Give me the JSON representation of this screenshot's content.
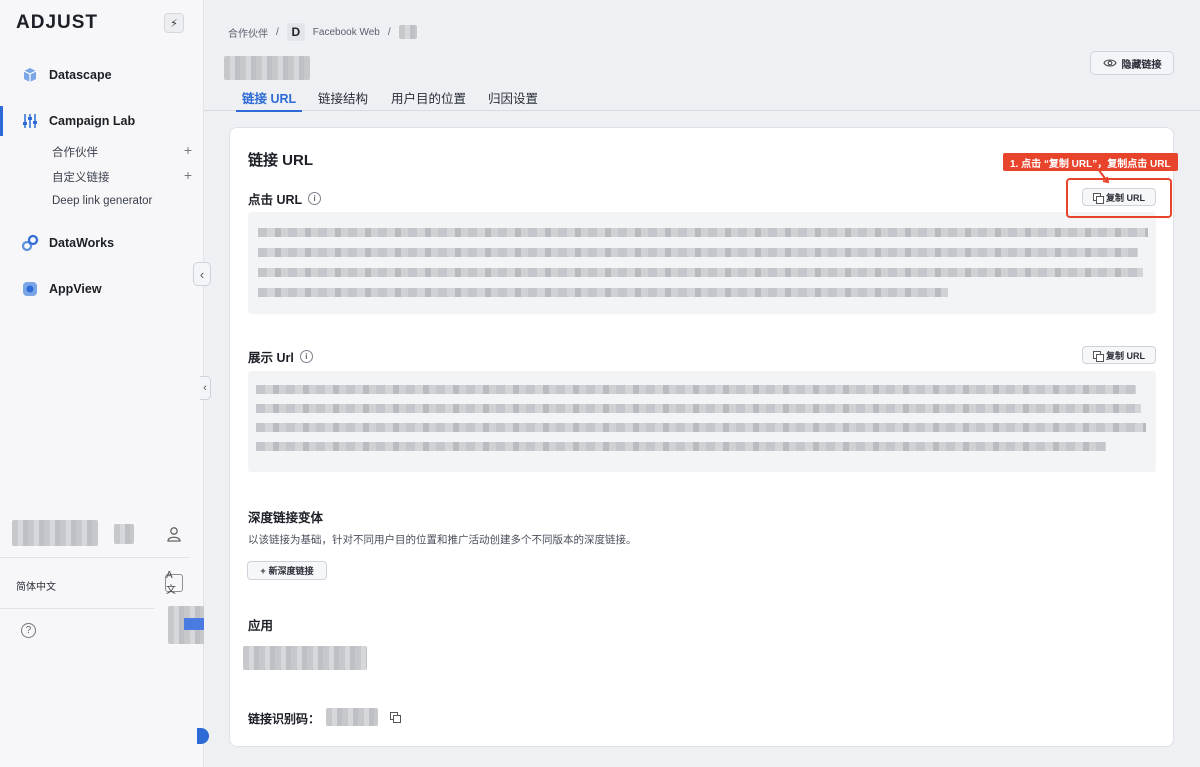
{
  "sidebar": {
    "logo": "ADJUST",
    "bolt_icon": "bolt-icon",
    "nav": [
      {
        "label": "Datascape",
        "icon": "datascape-icon"
      },
      {
        "label": "Campaign Lab",
        "icon": "campaign-lab-icon",
        "active": true
      },
      {
        "label": "DataWorks",
        "icon": "dataworks-icon"
      },
      {
        "label": "AppView",
        "icon": "appview-icon"
      }
    ],
    "sub_items": [
      {
        "label": "合作伙伴",
        "plus": "+"
      },
      {
        "label": "自定义链接",
        "plus": "+"
      },
      {
        "label": "Deep link generator",
        "plus": ""
      }
    ],
    "language": "简体中文",
    "lang_glyph": "A文",
    "help_glyph": "?"
  },
  "breadcrumb": {
    "partner": "合作伙伴",
    "sep": "/",
    "badge": "D",
    "platform": "Facebook Web"
  },
  "header": {
    "hide_link_label": "隐藏链接"
  },
  "tabs": [
    {
      "label": "链接 URL",
      "active": true
    },
    {
      "label": "链接结构"
    },
    {
      "label": "用户目的位置"
    },
    {
      "label": "归因设置"
    }
  ],
  "card": {
    "title": "链接 URL",
    "click_url_label": "点击 URL",
    "impression_url_label": "展示 Url",
    "copy_label": "复制 URL",
    "deeplink_title": "深度链接变体",
    "deeplink_desc": "以该链接为基础，针对不同用户目的位置和推广活动创建多个不同版本的深度链接。",
    "new_deeplink_label": "新深度链接",
    "new_plus": "+",
    "app_title": "应用",
    "link_id_label": "链接识别码：",
    "info_glyph": "i"
  },
  "annotation": {
    "text": "1. 点击 “复制 URL”，复制点击 URL",
    "color": "#e8442c"
  },
  "colors": {
    "accent": "#2f6bd6"
  }
}
